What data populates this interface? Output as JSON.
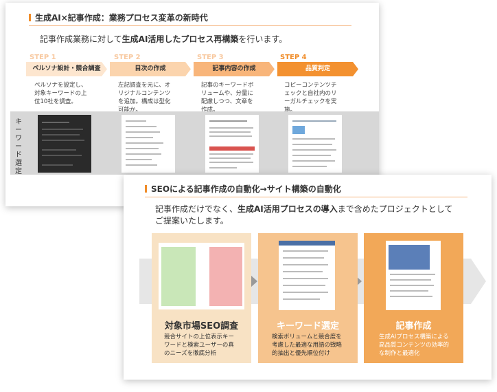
{
  "slide1": {
    "title": "生成AI×記事作成：業務プロセス変革の新時代",
    "lead_prefix": "記事作成業務に対して",
    "lead_bold": "生成AI活用したプロセス再構築",
    "lead_suffix": "を行います。",
    "steps": [
      {
        "step": "STEP 1",
        "label": "ペルソナ設計・競合調査",
        "desc": "ペルソナを設定し、対象キーワードの上位10社を調査。"
      },
      {
        "step": "STEP 2",
        "label": "目次の作成",
        "desc": "左記調査を元に、オリジナルコンテンツを追加。構成は型化可能か。"
      },
      {
        "step": "STEP 3",
        "label": "記事内容の作成",
        "desc": "記事のキーワードボリュームや、分量に配慮しつつ、文章を作成。"
      },
      {
        "step": "STEP 4",
        "label": "品質判定",
        "desc": "コピーコンテンツチェックと自社内のリーガルチェックを実施。"
      }
    ],
    "row_label": "キーワード選定"
  },
  "slide2": {
    "title": "SEOによる記事作成の自動化→サイト構築の自動化",
    "lead_prefix": "記事作成だけでなく、",
    "lead_bold": "生成AI活用プロセスの導入",
    "lead_suffix": "まで含めたプロジェクトとして",
    "lead_line2": "ご提案いたします。",
    "boxes": [
      {
        "title": "対象市場SEO調査",
        "desc": "競合サイトの上位表示キーワードと検索ユーザーの真のニーズを徹底分析"
      },
      {
        "title": "キーワード選定",
        "desc": "検索ボリュームと競合度を考慮した最適な用語の戦略的抽出と優先順位付け"
      },
      {
        "title": "記事作成",
        "desc": "生成AIプロセス構築による高品質コンテンツの効率的な制作と最適化"
      }
    ]
  },
  "colors": {
    "accent": "#f08c28",
    "step_light": "#f8c9a0",
    "box1": "#f8e2c4",
    "box2": "#f6c48e",
    "box3": "#f2a858"
  }
}
